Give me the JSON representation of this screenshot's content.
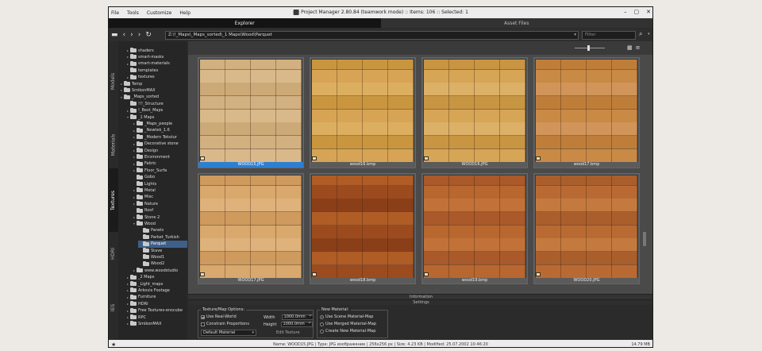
{
  "menu": [
    "File",
    "Tools",
    "Customize",
    "Help"
  ],
  "window": {
    "title": "Project Manager 2.80.84 (teamwork mode) :: Items: 106 :: Selected: 1"
  },
  "tabs": {
    "explorer": "Explorer",
    "asset_files": "Asset Files"
  },
  "nav": {
    "path": "Z:\\!_Maps\\_Maps_sorted\\_1 Maps\\Wood\\Parquet",
    "filter_placeholder": "Filter"
  },
  "sidebar_tabs": [
    "Models",
    "Materials",
    "Textures",
    "HDRI",
    "IES"
  ],
  "tree": [
    {
      "label": "shaders",
      "arrow": "▸"
    },
    {
      "label": "smart-masks",
      "arrow": "▸"
    },
    {
      "label": "smart-materials",
      "arrow": "▸"
    },
    {
      "label": "templates",
      "arrow": ""
    },
    {
      "label": "textures",
      "arrow": "▸"
    },
    {
      "label": "Temp",
      "arrow": "▸"
    },
    {
      "label": "SmikonMAX",
      "arrow": "▸"
    },
    {
      "label": "_Maps_sorted",
      "arrow": "▾"
    },
    {
      "label": "!!!_Structure",
      "arrow": ""
    },
    {
      "label": "!_Best_Maps",
      "arrow": "▸"
    },
    {
      "label": "_1 Maps",
      "arrow": "▾"
    },
    {
      "label": "_Maps_people",
      "arrow": "▸"
    },
    {
      "label": "_Newtek_1.6",
      "arrow": "▸"
    },
    {
      "label": "_Modern Tekstur",
      "arrow": "▸"
    },
    {
      "label": "Decorative stone",
      "arrow": "▸"
    },
    {
      "label": "Design",
      "arrow": "▸"
    },
    {
      "label": "Environment",
      "arrow": "▸"
    },
    {
      "label": "Fabric",
      "arrow": "▸"
    },
    {
      "label": "Floor_Surfa",
      "arrow": "▸"
    },
    {
      "label": "Gobo",
      "arrow": ""
    },
    {
      "label": "Lights",
      "arrow": ""
    },
    {
      "label": "Metal",
      "arrow": "▸"
    },
    {
      "label": "Misc",
      "arrow": "▸"
    },
    {
      "label": "Nature",
      "arrow": "▸"
    },
    {
      "label": "Roof",
      "arrow": ""
    },
    {
      "label": "Stone 2",
      "arrow": "▸"
    },
    {
      "label": "Wood",
      "arrow": "▾"
    },
    {
      "label": "Panels",
      "arrow": ""
    },
    {
      "label": "Parket_Turkish",
      "arrow": ""
    },
    {
      "label": "Parquet",
      "arrow": ""
    },
    {
      "label": "Stave",
      "arrow": ""
    },
    {
      "label": "Wood1",
      "arrow": ""
    },
    {
      "label": "Wood2",
      "arrow": ""
    },
    {
      "label": "www.woodstudio",
      "arrow": "▸"
    },
    {
      "label": "_2 Maps",
      "arrow": "▸"
    },
    {
      "label": "_Light_maps",
      "arrow": "▸"
    },
    {
      "label": "Arkovis Footage",
      "arrow": "▸"
    },
    {
      "label": "Furniture",
      "arrow": "▸"
    },
    {
      "label": "HDRI",
      "arrow": "▸"
    },
    {
      "label": "Free Textures-enscube",
      "arrow": "▸"
    },
    {
      "label": "RPC",
      "arrow": "▸"
    },
    {
      "label": "SmikonMAX",
      "arrow": "▸"
    }
  ],
  "thumbnails": [
    {
      "name": "WOOD15.JPG",
      "badge": "JPG"
    },
    {
      "name": "wood16.bmp",
      "badge": "BMP"
    },
    {
      "name": "WOOD16.JPG",
      "badge": "JPG"
    },
    {
      "name": "wood17.bmp",
      "badge": "BMP"
    },
    {
      "name": "WOOD17.JPG",
      "badge": "JPG"
    },
    {
      "name": "wood18.bmp",
      "badge": "BMP"
    },
    {
      "name": "wood19.bmp",
      "badge": "BMP"
    },
    {
      "name": "WOOD20.JPG",
      "badge": "JPG"
    }
  ],
  "panels": {
    "information": "Information",
    "settings": "Settings"
  },
  "texmap": {
    "title": "Texture/Map Options:",
    "use_real_world": "Use Real-World",
    "constrain": "Constrain Proportions",
    "width_label": "Width",
    "width_value": "1000.0mm",
    "height_label": "Height",
    "height_value": "1000.0mm",
    "material_select": "Default Material",
    "edit_texture": "Edit Texture"
  },
  "newmat": {
    "title": "New Material:",
    "opt1": "Use Scene Material-Map",
    "opt2": "Use Merged Material-Map",
    "opt3": "Create New Material-Map"
  },
  "status": {
    "text": "Name: WOOD15.JPG | Type: JPG изображение | 256x256 px | Size: 4.23 KB | Modified: 25.07.2002 10:46:20",
    "right": "14.79 MB"
  },
  "colors": {
    "accent": "#2d7fd2",
    "selection": "#3d5f8a",
    "background": "#2b2b2b"
  }
}
